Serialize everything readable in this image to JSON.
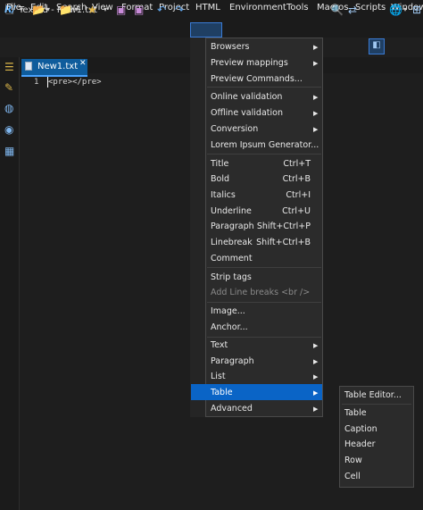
{
  "window": {
    "title": "TextEd - New1.txt"
  },
  "menubar": [
    "File",
    "Edit",
    "Search",
    "View",
    "Format",
    "Project",
    "HTML",
    "Environment",
    "Tools",
    "Macros",
    "Scripts",
    "Window"
  ],
  "tab": {
    "label": "New1.txt",
    "close": "✕"
  },
  "editor": {
    "line_number": "1",
    "code": "<pre></pre>"
  },
  "html_menu": {
    "items": [
      {
        "label": "Browsers",
        "shortcut": "",
        "submenu": true
      },
      {
        "label": "Preview mappings",
        "shortcut": "",
        "submenu": true
      },
      {
        "label": "Preview Commands...",
        "shortcut": "",
        "submenu": false
      },
      {
        "label": "Online validation",
        "shortcut": "",
        "submenu": true
      },
      {
        "label": "Offline validation",
        "shortcut": "",
        "submenu": true
      },
      {
        "label": "Conversion",
        "shortcut": "",
        "submenu": true
      },
      {
        "label": "Lorem Ipsum Generator...",
        "shortcut": "",
        "submenu": false
      },
      {
        "label": "Title",
        "shortcut": "Ctrl+T",
        "submenu": false
      },
      {
        "label": "Bold",
        "shortcut": "Ctrl+B",
        "submenu": false
      },
      {
        "label": "Italics",
        "shortcut": "Ctrl+I",
        "submenu": false
      },
      {
        "label": "Underline",
        "shortcut": "Ctrl+U",
        "submenu": false
      },
      {
        "label": "Paragraph",
        "shortcut": "Shift+Ctrl+P",
        "submenu": false
      },
      {
        "label": "Linebreak",
        "shortcut": "Shift+Ctrl+B",
        "submenu": false
      },
      {
        "label": "Comment",
        "shortcut": "",
        "submenu": false
      },
      {
        "label": "Strip tags",
        "shortcut": "",
        "submenu": false
      },
      {
        "label": "Add Line breaks <br />",
        "shortcut": "",
        "submenu": false,
        "disabled": true
      },
      {
        "label": "Image...",
        "shortcut": "",
        "submenu": false
      },
      {
        "label": "Anchor...",
        "shortcut": "",
        "submenu": false
      },
      {
        "label": "Text",
        "shortcut": "",
        "submenu": true
      },
      {
        "label": "Paragraph",
        "shortcut": "",
        "submenu": true
      },
      {
        "label": "List",
        "shortcut": "",
        "submenu": true
      },
      {
        "label": "Table",
        "shortcut": "",
        "submenu": true,
        "selected": true
      },
      {
        "label": "Advanced",
        "shortcut": "",
        "submenu": true
      }
    ]
  },
  "table_submenu": [
    "Table Editor...",
    "Table",
    "Caption",
    "Header",
    "Row",
    "Cell"
  ],
  "icons": {
    "app": "app-logo-icon",
    "toolbar": [
      "new-file-icon",
      "open-folder-icon",
      "reopen-icon",
      "favorites-star-icon",
      "save-icon",
      "save-all-icon",
      "undo-icon",
      "redo-icon",
      "find-icon",
      "replace-icon",
      "preview-icon",
      "browser-icon"
    ],
    "sidebar": [
      "document-list-icon",
      "clipboard-icon",
      "globe-icon",
      "ftp-icon",
      "projects-icon"
    ]
  }
}
